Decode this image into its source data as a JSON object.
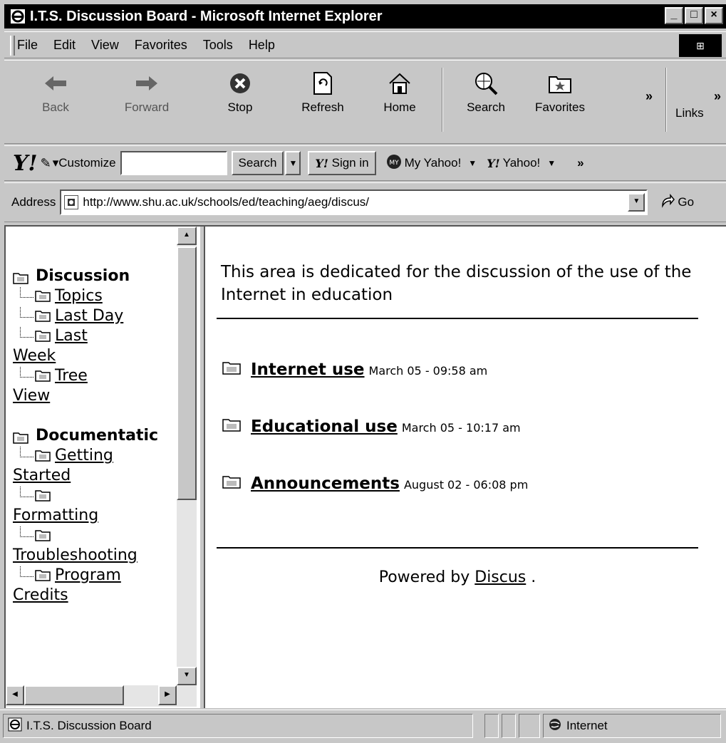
{
  "window": {
    "title": "I.T.S. Discussion Board - Microsoft Internet Explorer"
  },
  "menu": [
    "File",
    "Edit",
    "View",
    "Favorites",
    "Tools",
    "Help"
  ],
  "toolbar": {
    "back": "Back",
    "forward": "Forward",
    "stop": "Stop",
    "refresh": "Refresh",
    "home": "Home",
    "search": "Search",
    "favorites": "Favorites",
    "links": "Links"
  },
  "yahoo": {
    "customize": "Customize",
    "search_button": "Search",
    "sign_in": "Sign in",
    "my_yahoo": "My Yahoo!",
    "yahoo": "Yahoo!"
  },
  "address": {
    "label": "Address",
    "url": "http://www.shu.ac.uk/schools/ed/teaching/aeg/discus/",
    "go": "Go"
  },
  "sidebar": {
    "discussion": "Discussion",
    "topics": "Topics",
    "last_day": "Last Day",
    "last": "Last",
    "week": "Week",
    "tree": "Tree",
    "view": "View",
    "documentation": "Documentatic",
    "getting": "Getting",
    "started": "Started",
    "formatting": "Formatting",
    "troubleshooting": "Troubleshooting",
    "program": "Program",
    "credits": "Credits"
  },
  "main": {
    "intro": "This area is dedicated for the discussion of the use of the Internet in education",
    "topics": [
      {
        "title": "Internet use",
        "date": "March 05 - 09:58 am"
      },
      {
        "title": "Educational use",
        "date": "March 05 - 10:17 am"
      },
      {
        "title": "Announcements",
        "date": "August 02 - 06:08 pm"
      }
    ],
    "powered_by": "Powered by",
    "powered_link": "Discus",
    "powered_dot": "."
  },
  "status": {
    "page": "I.T.S. Discussion Board",
    "zone": "Internet"
  }
}
